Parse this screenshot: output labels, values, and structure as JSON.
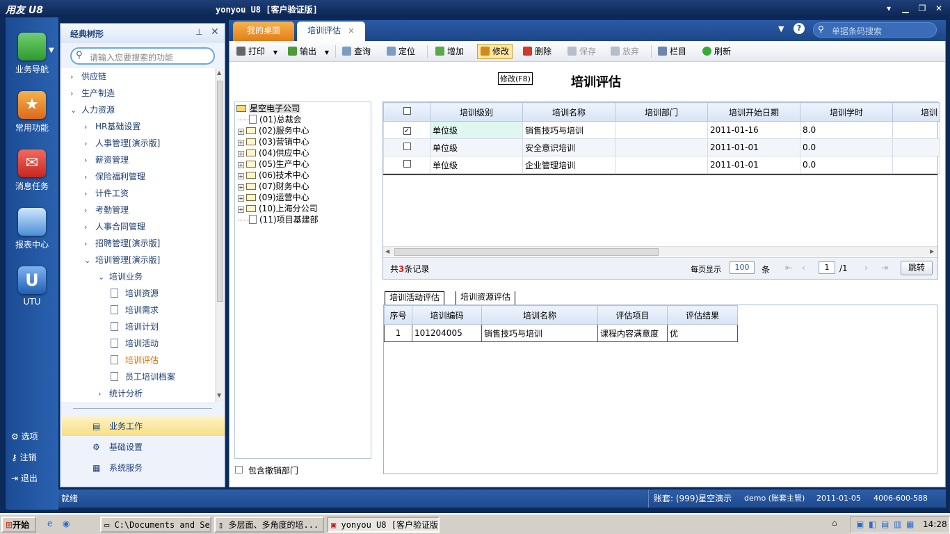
{
  "window": {
    "app_logo": "用友 U8",
    "title": "yonyou U8 [客户验证版]"
  },
  "left_nav": {
    "items": [
      {
        "label": "业务导航",
        "icon": "business-nav-icon",
        "color": "#3aa83a"
      },
      {
        "label": "常用功能",
        "icon": "star-icon",
        "color": "#e8822a"
      },
      {
        "label": "消息任务",
        "icon": "mail-icon",
        "color": "#d7342e"
      },
      {
        "label": "报表中心",
        "icon": "report-icon",
        "color": "#4a8fd8"
      },
      {
        "label": "UTU",
        "icon": "utu-icon",
        "color": "#2b6cc0"
      }
    ],
    "system": [
      {
        "label": "选项",
        "icon": "gear-icon"
      },
      {
        "label": "注销",
        "icon": "key-icon"
      },
      {
        "label": "退出",
        "icon": "exit-icon"
      }
    ]
  },
  "side_panel": {
    "title": "经典树形",
    "search_placeholder": "请输入您要搜索的功能",
    "tree": [
      {
        "label": "供应链",
        "level": 1,
        "state": "collapsed"
      },
      {
        "label": "生产制造",
        "level": 1,
        "state": "collapsed"
      },
      {
        "label": "人力资源",
        "level": 1,
        "state": "expanded"
      },
      {
        "label": "HR基础设置",
        "level": 2,
        "state": "collapsed"
      },
      {
        "label": "人事管理[演示版]",
        "level": 2,
        "state": "collapsed"
      },
      {
        "label": "薪资管理",
        "level": 2,
        "state": "collapsed"
      },
      {
        "label": "保险福利管理",
        "level": 2,
        "state": "collapsed"
      },
      {
        "label": "计件工资",
        "level": 2,
        "state": "collapsed"
      },
      {
        "label": "考勤管理",
        "level": 2,
        "state": "collapsed"
      },
      {
        "label": "人事合同管理",
        "level": 2,
        "state": "collapsed"
      },
      {
        "label": "招聘管理[演示版]",
        "level": 2,
        "state": "collapsed"
      },
      {
        "label": "培训管理[演示版]",
        "level": 2,
        "state": "expanded"
      },
      {
        "label": "培训业务",
        "level": 3,
        "state": "expanded"
      },
      {
        "label": "培训资源",
        "level": 4,
        "state": "leaf"
      },
      {
        "label": "培训需求",
        "level": 4,
        "state": "leaf"
      },
      {
        "label": "培训计划",
        "level": 4,
        "state": "leaf"
      },
      {
        "label": "培训活动",
        "level": 4,
        "state": "leaf"
      },
      {
        "label": "培训评估",
        "level": 4,
        "state": "leaf-selected"
      },
      {
        "label": "员工培训档案",
        "level": 4,
        "state": "leaf"
      },
      {
        "label": "统计分析",
        "level": 3,
        "state": "collapsed"
      }
    ],
    "groups": [
      {
        "label": "业务工作",
        "active": true
      },
      {
        "label": "基础设置",
        "active": false
      },
      {
        "label": "系统服务",
        "active": false
      }
    ]
  },
  "tabs": {
    "desktop": "我的桌面",
    "active": "培训评估",
    "close": "×",
    "search_placeholder": "单据条码搜索"
  },
  "toolbar": {
    "print": "打印",
    "export": "输出",
    "query": "查询",
    "locate": "定位",
    "add": "增加",
    "edit": "修改",
    "delete": "删除",
    "save": "保存",
    "discard": "放弃",
    "columns": "栏目",
    "refresh": "刷新"
  },
  "page": {
    "mode_badge": "修改(F8)",
    "title": "培训评估"
  },
  "org_tree": {
    "root": "星空电子公司",
    "nodes": [
      {
        "label": "(01)总裁会",
        "expandable": false
      },
      {
        "label": "(02)服务中心",
        "expandable": true
      },
      {
        "label": "(03)营销中心",
        "expandable": true
      },
      {
        "label": "(04)供应中心",
        "expandable": true
      },
      {
        "label": "(05)生产中心",
        "expandable": true
      },
      {
        "label": "(06)技术中心",
        "expandable": true
      },
      {
        "label": "(07)财务中心",
        "expandable": true
      },
      {
        "label": "(09)运营中心",
        "expandable": true
      },
      {
        "label": "(10)上海分公司",
        "expandable": true
      },
      {
        "label": "(11)项目基建部",
        "expandable": false
      }
    ],
    "include_cancelled": "包含撤销部门"
  },
  "grid1": {
    "columns": [
      "培训级别",
      "培训名称",
      "培训部门",
      "培训开始日期",
      "培训学时",
      "培训"
    ],
    "rows": [
      {
        "checked": true,
        "cells": [
          "单位级",
          "销售技巧与培训",
          "",
          "2011-01-16",
          "8.0",
          ""
        ]
      },
      {
        "checked": false,
        "cells": [
          "单位级",
          "安全意识培训",
          "",
          "2011-01-01",
          "0.0",
          ""
        ]
      },
      {
        "checked": false,
        "cells": [
          "单位级",
          "企业管理培训",
          "",
          "2011-01-01",
          "0.0",
          ""
        ]
      }
    ]
  },
  "pager": {
    "total_prefix": "共",
    "total": "3",
    "total_suffix": "条记录",
    "per_page_label": "每页显示",
    "per_page": "100",
    "per_page_unit": "条",
    "page": "1",
    "of": "/1",
    "jump": "跳转"
  },
  "eval_tabs": [
    "培训活动评估",
    "培训资源评估"
  ],
  "grid2": {
    "columns": [
      "序号",
      "培训编码",
      "培训名称",
      "评估项目",
      "评估结果"
    ],
    "rows": [
      [
        "1",
        "101204005",
        "销售技巧与培训",
        "课程内容满意度",
        "优"
      ]
    ]
  },
  "status": {
    "ready": "就绪",
    "account": "账套: (999)星空演示",
    "user": "demo (账套主管)",
    "date": "2011-01-05",
    "phone": "4006-600-588"
  },
  "taskbar": {
    "start": "开始",
    "tasks": [
      "C:\\Documents and Se...",
      "多层面、多角度的培...",
      "yonyou U8 [客户验证版]"
    ],
    "clock": "14:28"
  }
}
